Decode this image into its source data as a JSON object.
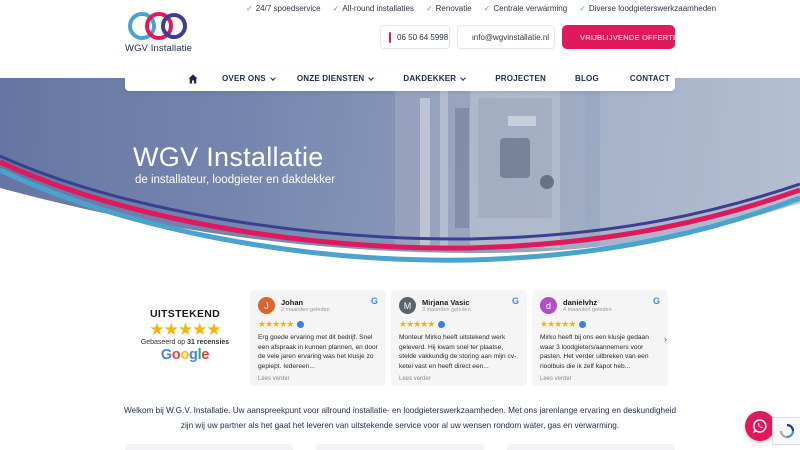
{
  "header": {
    "logo_text": "WGV Installatie",
    "usps": [
      "24/7 spoedservice",
      "All-round installaties",
      "Renovatie",
      "Centrale verwarming",
      "Diverse loodgieterswerkzaamheden"
    ],
    "phone": "06 50 64 5998",
    "email": "info@wgvinstallatie.nl",
    "cta": "VRIJBLIJVENDE OFFERTE"
  },
  "nav": {
    "home_icon": "home-icon",
    "items": [
      {
        "label": "OVER ONS",
        "dropdown": true
      },
      {
        "label": "ONZE DIENSTEN",
        "dropdown": true
      },
      {
        "label": "DAKDEKKER",
        "dropdown": true
      },
      {
        "label": "PROJECTEN",
        "dropdown": false
      },
      {
        "label": "BLOG",
        "dropdown": false
      },
      {
        "label": "CONTACT",
        "dropdown": false
      }
    ]
  },
  "hero": {
    "title": "WGV Installatie",
    "subtitle": "de installateur, loodgieter en dakdekker"
  },
  "reviews": {
    "summary_title": "UITSTEKEND",
    "stars": "★★★★★",
    "based_prefix": "Gebaseerd op",
    "based_count": "31 recensies",
    "google": "Google",
    "items": [
      {
        "initial": "J",
        "name": "Johan",
        "date": "2 maanden geleden",
        "text": "Erg goede ervaring met dit bedrijf. Snel een afspraak in kunnen plannen, en door de vele jaren ervaring was het klusje zo gepiept. Iedereen...",
        "read_more": "Lees verder",
        "avatar_color": "#e0622c"
      },
      {
        "initial": "M",
        "name": "Mirjana Vasic",
        "date": "3 maanden geleden",
        "text": "Monteur Mirko heeft uitstekend werk geleverd. Hij kwam snel ter plaatse, stelde vakkundig de storing aan mijn cv-ketel vast en heeft direct een...",
        "read_more": "Lees verder",
        "avatar_color": "#5a6470"
      },
      {
        "initial": "d",
        "name": "danielvhz",
        "date": "4 maanden geleden",
        "text": "Mirko heeft bij ons een klusje gedaan waar 3 loodgieters/aannemers voor pasten. Het verder uitbreken van een rioolbuis die ik zelf kapot heb...",
        "read_more": "Lees verder",
        "avatar_color": "#b14fc5"
      }
    ]
  },
  "intro": {
    "text": "Welkom bij W.G.V. Installatie. Uw aanspreekpunt voor allround installatie- en loodgieterswerkzaamheden. Met ons jarenlange ervaring en deskundigheid zijn wij uw partner als het gaat het leveren van uitstekende service voor al uw wensen rondom water, gas en verwarming."
  },
  "colors": {
    "accent": "#e0195c",
    "navy": "#1d2b4f",
    "blue_stripe": "#4aa3cc",
    "star": "#f7b400"
  }
}
